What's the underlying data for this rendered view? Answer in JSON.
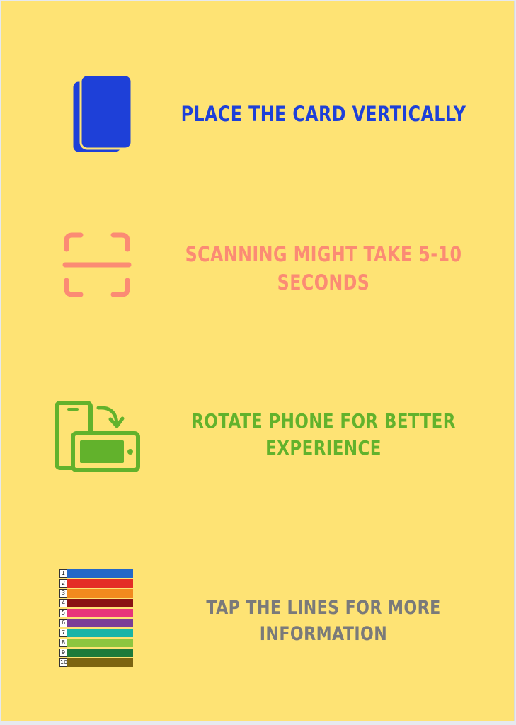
{
  "instructions": [
    {
      "text": "Place the card vertically",
      "color": "#1e40d8",
      "icon": "cards-icon"
    },
    {
      "text": "Scanning might take 5-10\nseconds",
      "color": "#fb8b74",
      "icon": "scan-frame-icon"
    },
    {
      "text": "Rotate phone for better\nexperience",
      "color": "#62b22c",
      "icon": "rotate-phone-icon"
    },
    {
      "text": "Tap the lines for more\ninformation",
      "color": "#7a7a7a",
      "icon": "lines-legend-icon"
    }
  ],
  "lines_legend": [
    {
      "number": "1",
      "color": "#2368c8"
    },
    {
      "number": "2",
      "color": "#e42d26"
    },
    {
      "number": "3",
      "color": "#f28a1e"
    },
    {
      "number": "4",
      "color": "#8a1313"
    },
    {
      "number": "5",
      "color": "#e8357a"
    },
    {
      "number": "6",
      "color": "#7b3d97"
    },
    {
      "number": "7",
      "color": "#19b4a7"
    },
    {
      "number": "8",
      "color": "#8dc63f"
    },
    {
      "number": "9",
      "color": "#1e7a3a"
    },
    {
      "number": "10",
      "color": "#7c6410"
    }
  ]
}
